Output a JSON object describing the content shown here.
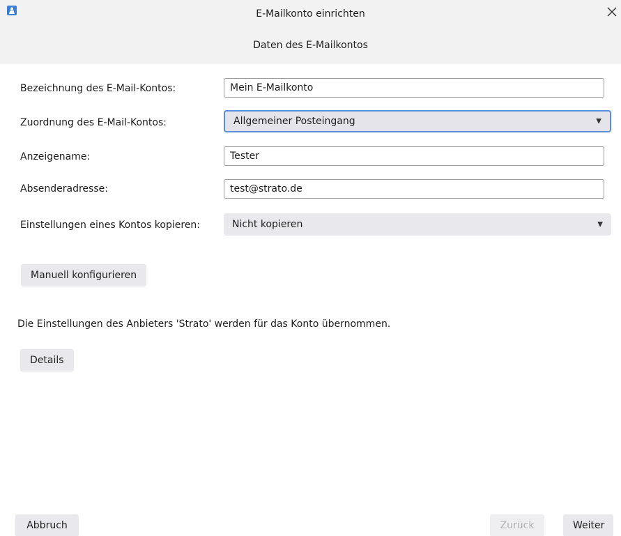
{
  "window": {
    "title": "E-Mailkonto einrichten",
    "subtitle": "Daten des E-Mailkontos",
    "app_icon": "app-icon",
    "close_icon": "close-icon"
  },
  "form": {
    "account_name": {
      "label": "Bezeichnung des E-Mail-Kontos:",
      "value": "Mein E-Mailkonto"
    },
    "assignment": {
      "label": "Zuordnung des E-Mail-Kontos:",
      "selected": "Allgemeiner Posteingang"
    },
    "display_name": {
      "label": "Anzeigename:",
      "value": "Tester"
    },
    "sender_address": {
      "label": "Absenderadresse:",
      "value": "test@strato.de"
    },
    "copy_settings": {
      "label": "Einstellungen eines Kontos kopieren:",
      "selected": "Nicht kopieren"
    }
  },
  "buttons": {
    "manual_config": "Manuell konfigurieren",
    "details": "Details",
    "cancel": "Abbruch",
    "back": "Zurück",
    "next": "Weiter"
  },
  "info_text": "Die Einstellungen des Anbieters 'Strato' werden für das Konto übernommen.",
  "colors": {
    "accent_focus": "#5b8ed8",
    "button_bg": "#e9e9ed",
    "disabled_text": "#b0b0b0",
    "titlebar_bg": "#f2f2f2"
  }
}
